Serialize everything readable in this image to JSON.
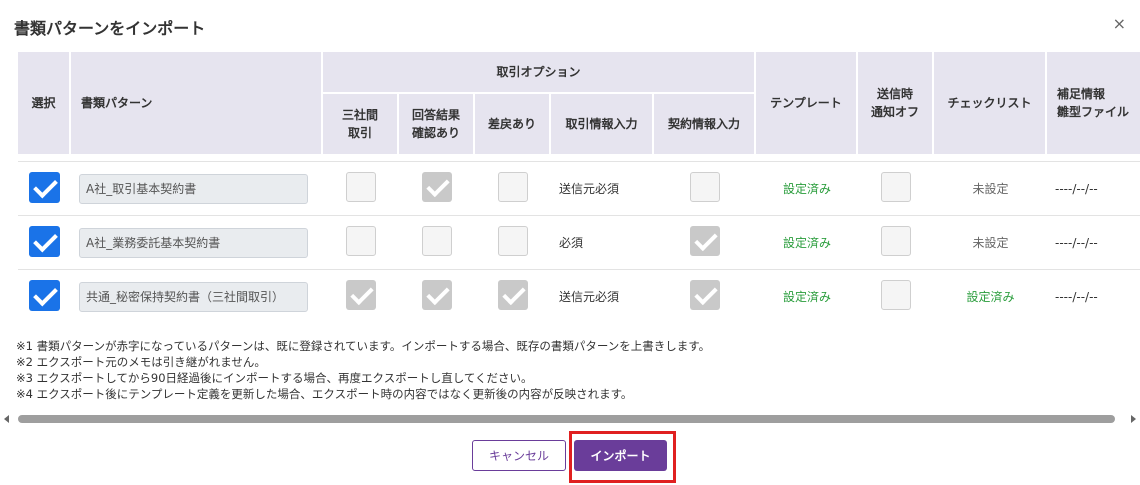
{
  "dialog": {
    "title": "書類パターンをインポート",
    "close_label": "×"
  },
  "table": {
    "headers": {
      "select": "選択",
      "pattern": "書類パターン",
      "options_group": "取引オプション",
      "three_party": "三社間取引",
      "reply_confirm": "回答結果確認あり",
      "sendback": "差戻あり",
      "deal_info": "取引情報入力",
      "contract_info": "契約情報入力",
      "template": "テンプレート",
      "notify_off": "送信時通知オフ",
      "checklist": "チェックリスト",
      "supplement": "補足情報雛型ファイル"
    },
    "rows": [
      {
        "selected": true,
        "pattern": "A社_取引基本契約書",
        "three_party": "off",
        "reply_confirm": "disabled",
        "sendback": "off",
        "deal_info": "送信元必須",
        "contract_info": "off",
        "template": "設定済み",
        "notify_off": "off",
        "checklist": "未設定",
        "supplement": "----/--/--"
      },
      {
        "selected": true,
        "pattern": "A社_業務委託基本契約書",
        "three_party": "off",
        "reply_confirm": "off",
        "sendback": "off",
        "deal_info": "必須",
        "contract_info": "disabled",
        "template": "設定済み",
        "notify_off": "off",
        "checklist": "未設定",
        "supplement": "----/--/--"
      },
      {
        "selected": true,
        "pattern": "共通_秘密保持契約書（三社間取引）",
        "three_party": "disabled",
        "reply_confirm": "disabled",
        "sendback": "disabled",
        "deal_info": "送信元必須",
        "contract_info": "disabled",
        "template": "設定済み",
        "notify_off": "off",
        "checklist": "設定済み",
        "supplement": "----/--/--"
      }
    ]
  },
  "notes": [
    "※1 書類パターンが赤字になっているパターンは、既に登録されています。インポートする場合、既存の書類パターンを上書きします。",
    "※2 エクスポート元のメモは引き継がれません。",
    "※3 エクスポートしてから90日経過後にインポートする場合、再度エクスポートし直してください。",
    "※4 エクスポート後にテンプレート定義を更新した場合、エクスポート時の内容ではなく更新後の内容が反映されます。"
  ],
  "buttons": {
    "cancel": "キャンセル",
    "import": "インポート"
  },
  "colors": {
    "accent": "#6a3d9a",
    "checkbox": "#1a73e8",
    "success_text": "#2a9d3c",
    "highlight": "#e02020"
  }
}
